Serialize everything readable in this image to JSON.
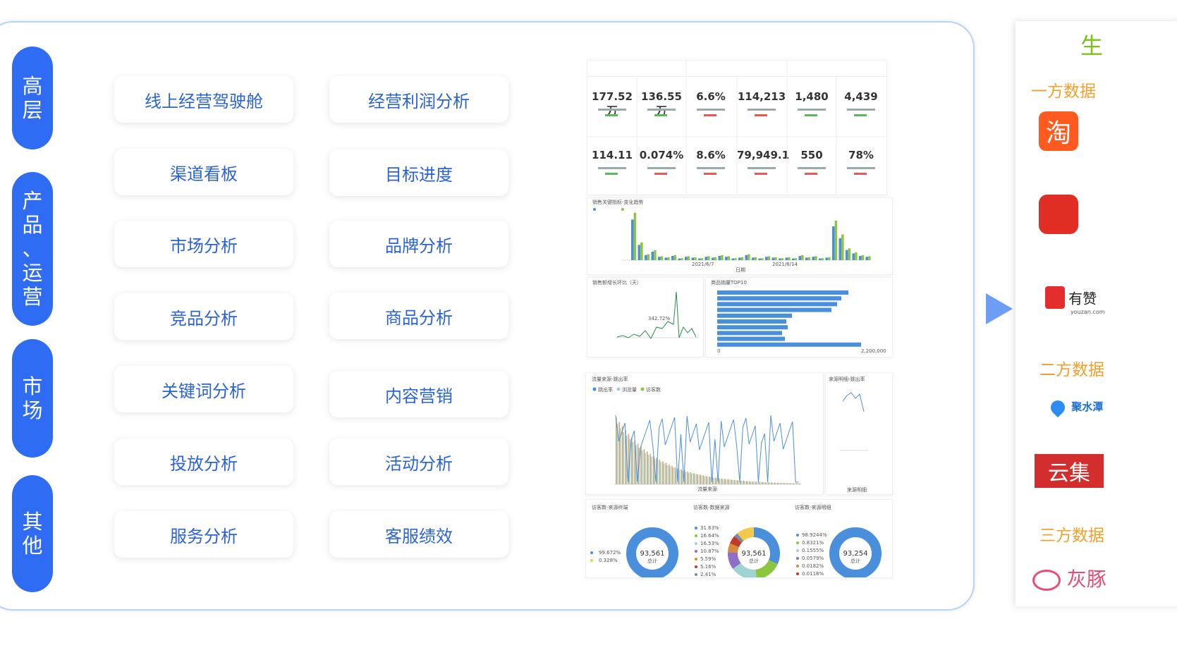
{
  "left_tags": [
    {
      "label": "高层",
      "chars": [
        "高",
        "层"
      ]
    },
    {
      "label": "产品、运营",
      "chars": [
        "产",
        "品",
        "、",
        "运",
        "营"
      ]
    },
    {
      "label": "市场",
      "chars": [
        "市",
        "场"
      ]
    },
    {
      "label": "其他",
      "chars": [
        "其",
        "他"
      ]
    }
  ],
  "buttons": [
    "线上经营驾驶舱",
    "经营利润分析",
    "渠道看板",
    "目标进度",
    "市场分析",
    "品牌分析",
    "竞品分析",
    "商品分析",
    "关键词分析",
    "内容营销",
    "投放分析",
    "活动分析",
    "服务分析",
    "客服绩效"
  ],
  "dashboard": {
    "kpi_row1": [
      "177.52万",
      "136.55万",
      "6.6%",
      "114,213",
      "1,480",
      "4,439"
    ],
    "kpi_row2": [
      "114.11",
      "0.074%",
      "8.6%",
      "79,949.1",
      "550",
      "78%"
    ],
    "trend_title": "销售关键指标-变化趋势",
    "trend_xlabel": "日期",
    "trend_dates": [
      "2021/6/7",
      "2021/6/14"
    ],
    "growth_title": "销售额增长环比（天）",
    "growth_peak": "342.72%",
    "top10_title": "商品销量TOP10",
    "top10_axis": [
      "0",
      "2,200,000"
    ],
    "traffic_title": "流量来源-跳出率",
    "traffic_legend": [
      "跳出率",
      "浏览量",
      "访客数"
    ],
    "traffic_xlabel": "流量来源",
    "source_title": "来源明细-跳出率",
    "source_xlabel": "来源明细",
    "donut1_title": "访客数-来源终端",
    "donut1_value": "93,561",
    "donut1_legend": [
      "99.672%",
      "0.328%"
    ],
    "donut2_title": "访客数-数据来源",
    "donut2_value": "93,561",
    "donut2_legend": [
      "31.63%",
      "16.64%",
      "16.53%",
      "10.87%",
      "5.59%",
      "5.16%",
      "2.41%"
    ],
    "donut3_title": "访客数-来源明细",
    "donut3_value": "93,254",
    "donut3_legend": [
      "98.9244%",
      "0.8321%",
      "0.1555%",
      "0.0579%",
      "0.0182%",
      "0.0118%"
    ],
    "donut_sub": "总计"
  },
  "right": {
    "title": "生",
    "first_party": "一方数据",
    "second_party": "二方数据",
    "third_party": "三方数据",
    "youzan": "有赞",
    "youzan_sub": "youzan.com",
    "jushuitan": "聚水潭",
    "yunji": "云集",
    "huitun": "灰豚"
  },
  "colors": {
    "accent": "#2f6cf4",
    "button_text": "#2a63d8",
    "orange": "#f1a12a",
    "green": "#7cc11b",
    "bar_blue": "#4a8fdb",
    "bar_green": "#8cc63f"
  }
}
